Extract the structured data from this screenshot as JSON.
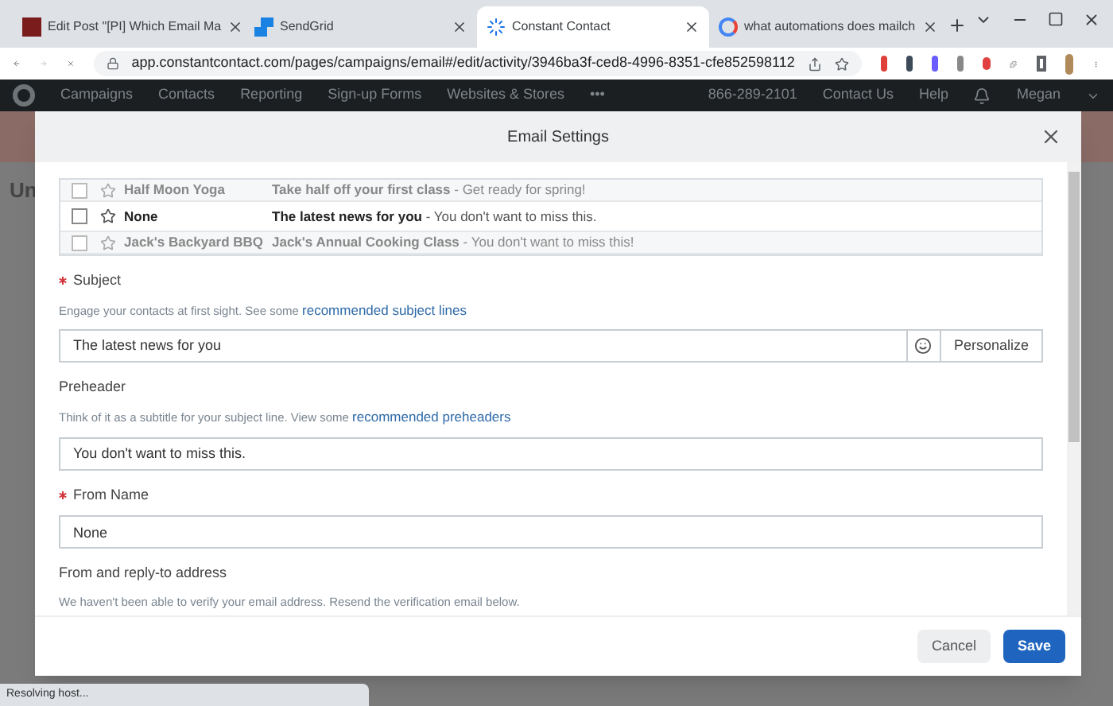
{
  "browser": {
    "tabs": [
      {
        "title": "Edit Post \"[PI] Which Email Ma",
        "selected": false
      },
      {
        "title": "SendGrid",
        "selected": false
      },
      {
        "title": "Constant Contact",
        "selected": true
      },
      {
        "title": "what automations does mailch",
        "selected": false
      }
    ],
    "url": "app.constantcontact.com/pages/campaigns/email#/edit/activity/3946ba3f-ced8-4996-8351-cfe852598112",
    "status": "Resolving host..."
  },
  "nav": {
    "items": [
      "Campaigns",
      "Contacts",
      "Reporting",
      "Sign-up Forms",
      "Websites & Stores",
      "•••"
    ],
    "phone": "866-289-2101",
    "contact": "Contact Us",
    "help": "Help",
    "user": "Megan"
  },
  "page": {
    "heading": "Un"
  },
  "dialog": {
    "title": "Email Settings",
    "emails": [
      {
        "from": "Half Moon Yoga",
        "subject": "Take half off your first class",
        "preheader": " - Get ready for spring!",
        "dimmed": true
      },
      {
        "from": "None",
        "subject": "The latest news for you",
        "preheader": " - You don't want to miss this.",
        "dimmed": false
      },
      {
        "from": "Jack's Backyard BBQ",
        "subject": "Jack's Annual Cooking Class",
        "preheader": " - You don't want to miss this!",
        "dimmed": true
      }
    ],
    "fields": [
      {
        "label": "Subject",
        "required": true,
        "hint": "Engage your contacts at first sight. See some",
        "link": "recommended subject lines",
        "value": "The latest news for you",
        "kind": "subject",
        "action": "Personalize"
      },
      {
        "label": "Preheader",
        "required": false,
        "hint": "Think of it as a subtitle for your subject line. View some",
        "link": "recommended preheaders",
        "value": "You don't want to miss this.",
        "kind": "text"
      },
      {
        "label": "From Name",
        "required": true,
        "value": "None",
        "kind": "text"
      },
      {
        "label": "From and reply-to address",
        "required": false,
        "hint": "We haven't been able to verify your email address. Resend the verification email below.",
        "kind": "note"
      }
    ],
    "buttons": [
      "Cancel",
      "Save"
    ]
  }
}
